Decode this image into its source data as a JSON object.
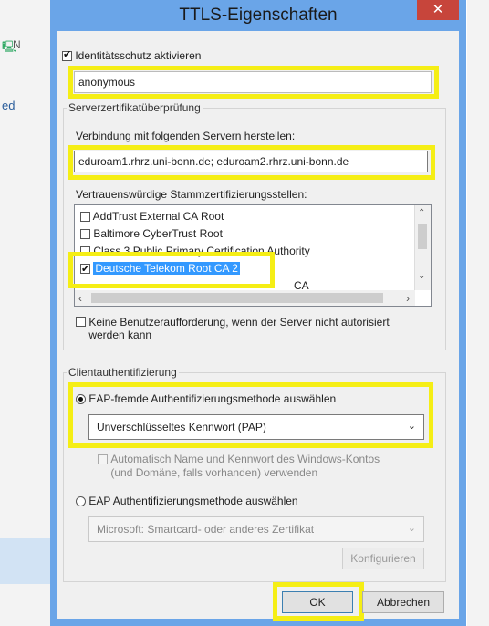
{
  "background": {
    "left_text_1": "ed",
    "left_text_2": "N"
  },
  "dialog": {
    "title": "TTLS-Eigenschaften",
    "close_glyph": "✕"
  },
  "identity": {
    "checkbox_label": "Identitätsschutz aktivieren",
    "checked": true,
    "value": "anonymous"
  },
  "server_cert": {
    "group_label": "Serverzertifikatüberprüfung",
    "connect_label": "Verbindung mit folgenden Servern herstellen:",
    "servers_value": "eduroam1.rhrz.uni-bonn.de; eduroam2.rhrz.uni-bonn.de",
    "trusted_label": "Vertrauenswürdige Stammzertifizierungsstellen:",
    "ca_items": [
      {
        "label": "AddTrust External CA Root",
        "checked": false
      },
      {
        "label": "Baltimore CyberTrust Root",
        "checked": false
      },
      {
        "label": "Class 3 Public Primary Certification Authority",
        "checked": false
      },
      {
        "label": "Deutsche Telekom Root CA 2",
        "checked": true
      },
      {
        "label": "CA",
        "checked": false
      }
    ],
    "no_prompt_label": "Keine Benutzeraufforderung, wenn der Server nicht autorisiert werden kann"
  },
  "client_auth": {
    "group_label": "Clientauthentifizierung",
    "eap_foreign_label": "EAP-fremde Authentifizierungsmethode auswählen",
    "method_value": "Unverschlüsseltes Kennwort (PAP)",
    "auto_windows_label_1": "Automatisch Name und Kennwort des Windows-Kontos",
    "auto_windows_label_2": "(und Domäne, falls vorhanden) verwenden",
    "eap_label": "EAP Authentifizierungsmethode auswählen",
    "eap_method_value": "Microsoft: Smartcard- oder anderes Zertifikat",
    "configure_label": "Konfigurieren"
  },
  "buttons": {
    "ok": "OK",
    "cancel": "Abbrechen"
  },
  "colors": {
    "highlight": "#f5ee15",
    "selection": "#3399ff",
    "title_bar": "#6aa5e8",
    "close": "#c7453b"
  }
}
